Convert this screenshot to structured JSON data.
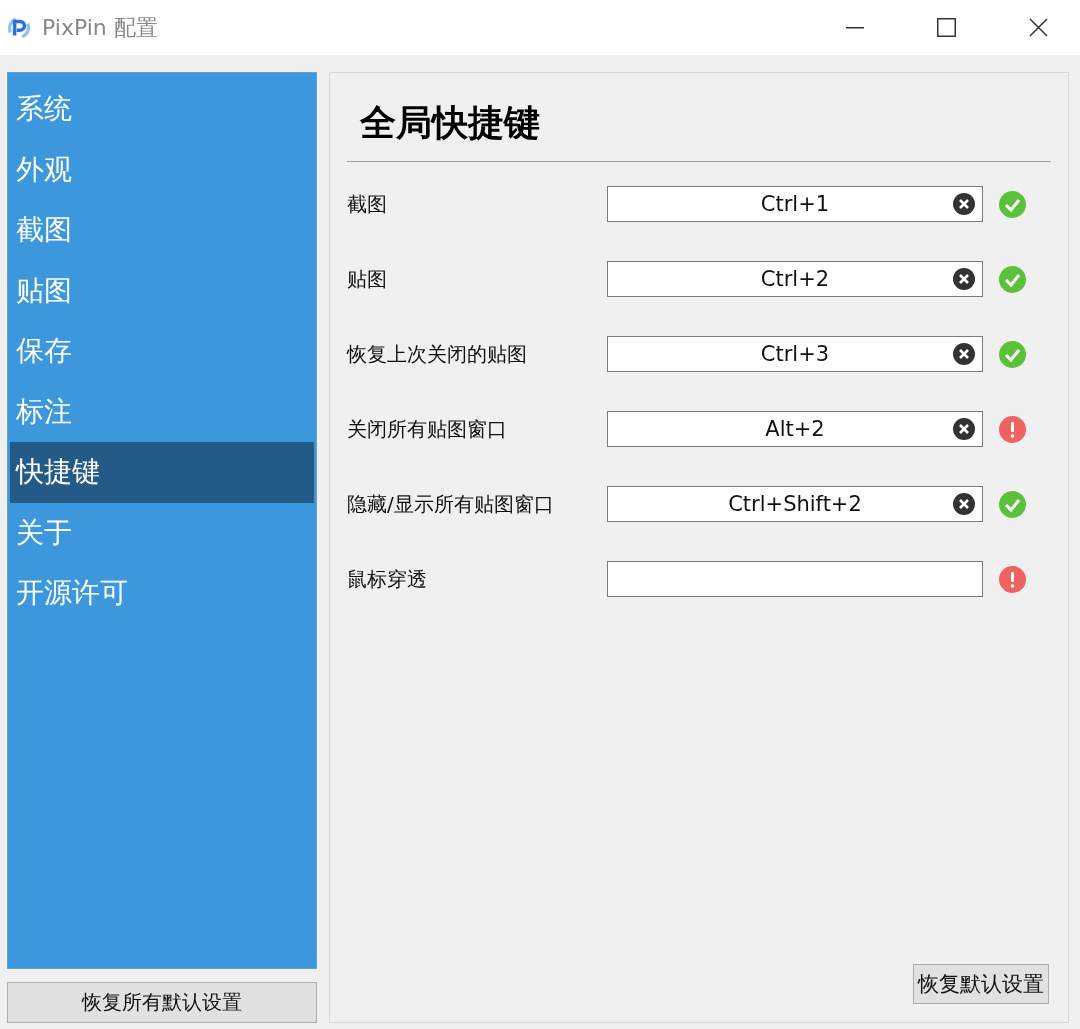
{
  "window": {
    "title": "PixPin 配置"
  },
  "sidebar": {
    "items": [
      {
        "label": "系统",
        "selected": false
      },
      {
        "label": "外观",
        "selected": false
      },
      {
        "label": "截图",
        "selected": false
      },
      {
        "label": "贴图",
        "selected": false
      },
      {
        "label": "保存",
        "selected": false
      },
      {
        "label": "标注",
        "selected": false
      },
      {
        "label": "快捷键",
        "selected": true
      },
      {
        "label": "关于",
        "selected": false
      },
      {
        "label": "开源许可",
        "selected": false
      }
    ],
    "reset_all_button": "恢复所有默认设置"
  },
  "panel": {
    "heading": "全局快捷键",
    "shortcuts": [
      {
        "label": "截图",
        "value": "Ctrl+1",
        "kind": "ok"
      },
      {
        "label": "贴图",
        "value": "Ctrl+2",
        "kind": "ok"
      },
      {
        "label": "恢复上次关闭的贴图",
        "value": "Ctrl+3",
        "kind": "ok"
      },
      {
        "label": "关闭所有贴图窗口",
        "value": "Alt+2",
        "kind": "error"
      },
      {
        "label": "隐藏/显示所有贴图窗口",
        "value": "Ctrl+Shift+2",
        "kind": "ok"
      },
      {
        "label": "鼠标穿透",
        "kind": "error"
      }
    ],
    "reset_button": "恢复默认设置"
  }
}
